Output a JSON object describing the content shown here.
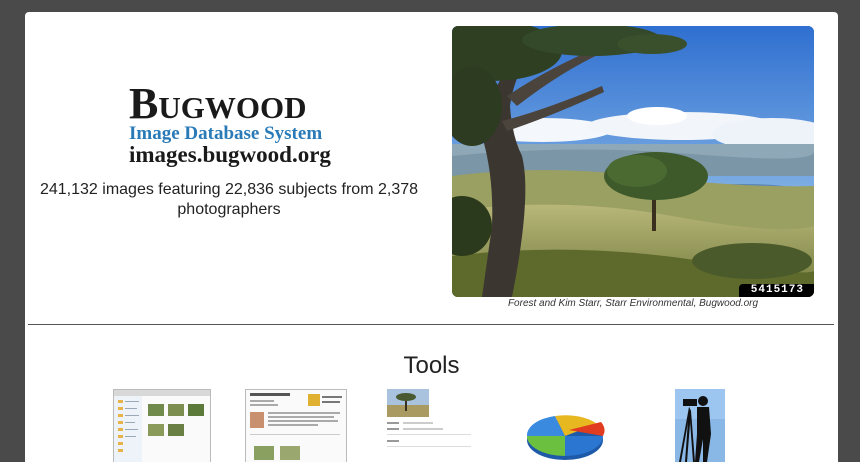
{
  "logo": {
    "wordmark": "Bugwood",
    "subtitle": "Image Database System",
    "url": "images.bugwood.org"
  },
  "stats": {
    "text": "241,132 images featuring 22,836 subjects from 2,378 photographers"
  },
  "hero": {
    "image_id": "5415173",
    "caption": "Forest and Kim Starr, Starr Environmental, Bugwood.org"
  },
  "tools": {
    "title": "Tools",
    "items": [
      {
        "icon": "file-browser-thumbnail"
      },
      {
        "icon": "photographer-page-thumbnail"
      },
      {
        "icon": "image-detail-thumbnail"
      },
      {
        "icon": "pie-chart-icon"
      },
      {
        "icon": "photographer-silhouette-icon"
      }
    ]
  },
  "colors": {
    "background": "#4a4a4a",
    "accent": "#2a7ab8",
    "page": "#ffffff"
  }
}
